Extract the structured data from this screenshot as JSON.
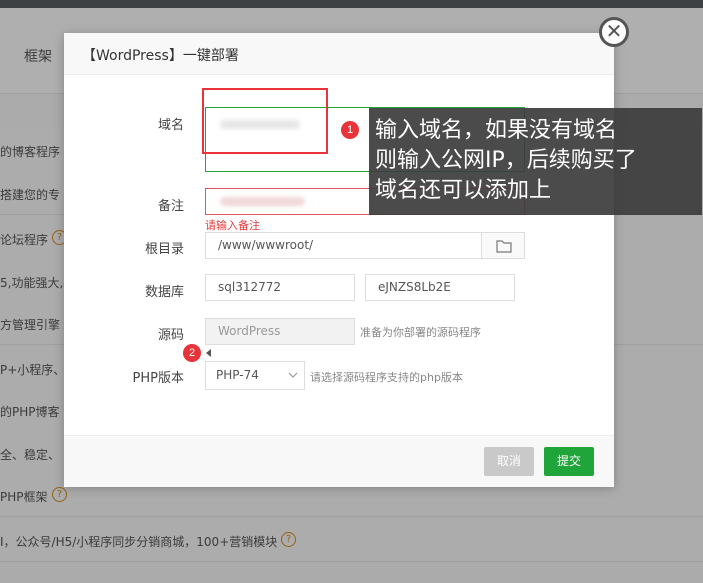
{
  "background": {
    "tab_label": "框架",
    "rows": [
      {
        "text": "的博客程序",
        "help": true
      },
      {
        "text": "搭建您的专",
        "help": false
      },
      {
        "text": "论坛程序",
        "help": true
      },
      {
        "text": "5,功能强大,插",
        "help": false
      },
      {
        "text": "方管理引擎",
        "help": false
      },
      {
        "text": "P+小程序、关",
        "help": false
      },
      {
        "text": "的PHP博客",
        "help": false
      },
      {
        "text": "全、稳定、",
        "help": false
      },
      {
        "text": "PHP框架",
        "help": true
      },
      {
        "text": "I，公众号/H5/小程序同步分销商城，100+营销模块",
        "help": true
      }
    ],
    "help_glyph": "?"
  },
  "dialog": {
    "title": "【WordPress】一键部署",
    "close_glyph": "✕",
    "fields": {
      "domain_label": "域名",
      "remark_label": "备注",
      "remark_error": "请输入备注",
      "root_label": "根目录",
      "root_value": "/www/wwwroot/",
      "database_label": "数据库",
      "db_name": "sql312772",
      "db_password": "eJNZS8Lb2E",
      "source_label": "源码",
      "source_value": "WordPress",
      "source_hint": "准备为你部署的源码程序",
      "php_label": "PHP版本",
      "php_value": "PHP-74",
      "php_hint": "请选择源码程序支持的php版本"
    },
    "buttons": {
      "cancel": "取消",
      "submit": "提交"
    }
  },
  "annotations": {
    "badge1": "1",
    "badge2": "2",
    "tip_lines": [
      "输入域名，如果没有域名",
      "则输入公网IP，后续购买了",
      "域名还可以添加上"
    ]
  },
  "colors": {
    "accent_green": "#20a53a",
    "error_red": "#e43a3a",
    "annotation_red": "#e8333a"
  }
}
